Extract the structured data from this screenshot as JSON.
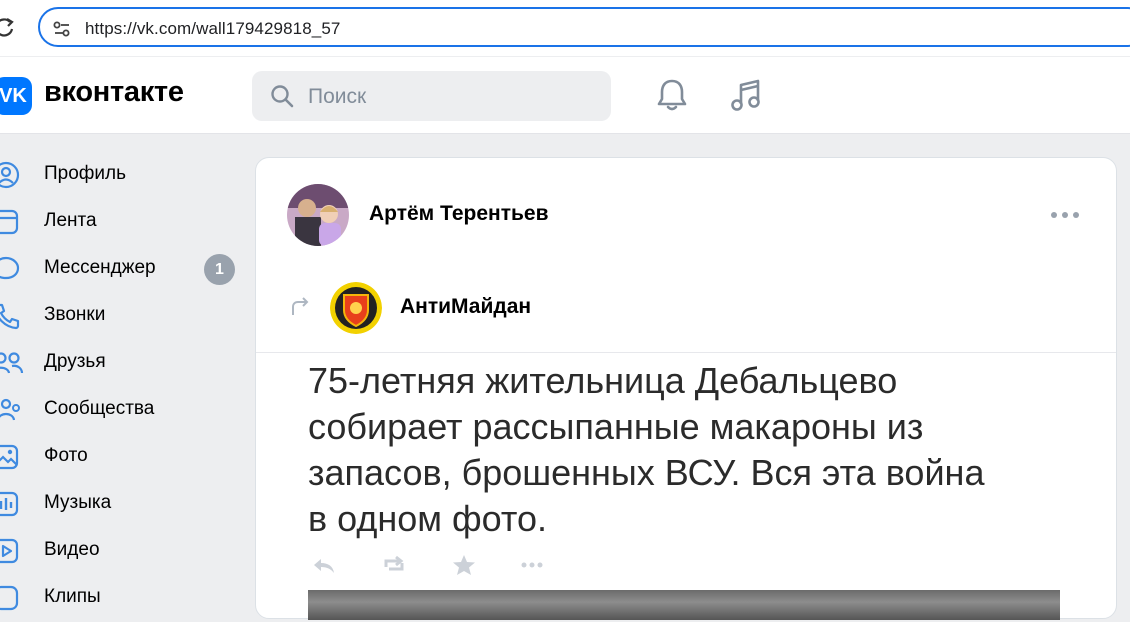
{
  "browser": {
    "url": "https://vk.com/wall179429818_57"
  },
  "header": {
    "logo_text": "VK",
    "wordmark": "вконтакте",
    "search_placeholder": "Поиск"
  },
  "nav": {
    "items": [
      {
        "label": "Профиль",
        "icon": "profile-icon"
      },
      {
        "label": "Лента",
        "icon": "feed-icon"
      },
      {
        "label": "Мессенджер",
        "icon": "messenger-icon",
        "badge": "1"
      },
      {
        "label": "Звонки",
        "icon": "phone-icon"
      },
      {
        "label": "Друзья",
        "icon": "friends-icon"
      },
      {
        "label": "Сообщества",
        "icon": "communities-icon"
      },
      {
        "label": "Фото",
        "icon": "photo-icon"
      },
      {
        "label": "Музыка",
        "icon": "music-icon"
      },
      {
        "label": "Видео",
        "icon": "video-icon"
      },
      {
        "label": "Клипы",
        "icon": "clips-icon"
      }
    ]
  },
  "post": {
    "author": "Артём Терентьев",
    "repost_source": "АнтиМайдан",
    "text_lines": [
      "75-летняя жительница Дебальцево",
      "собирает рассыпанные макароны из",
      "запасов, брошенных ВСУ. Вся эта война",
      "в одном фото."
    ]
  },
  "colors": {
    "accent": "#0077ff",
    "page_bg": "#edeef0",
    "badge": "#99a2ad",
    "url_border": "#1a73e8"
  }
}
